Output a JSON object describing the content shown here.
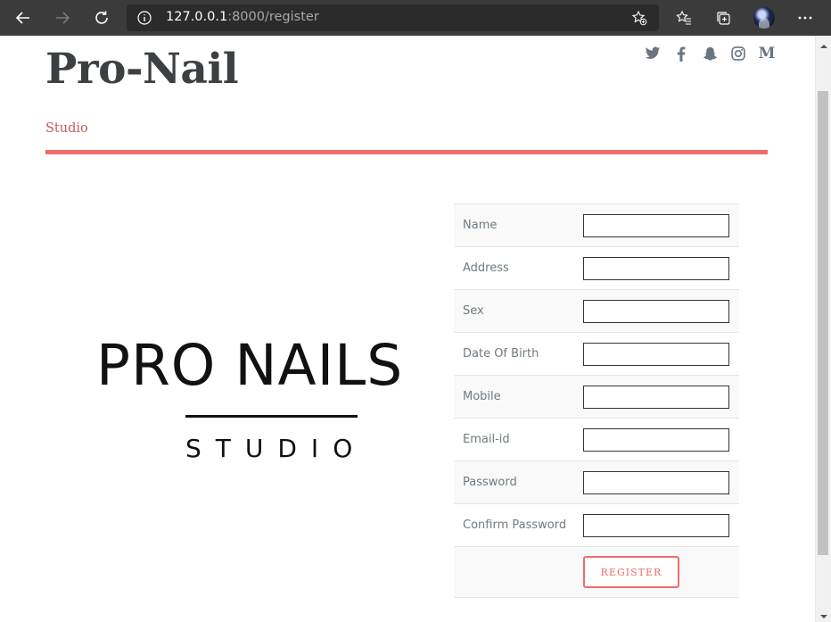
{
  "browser": {
    "url_host": "127.0.0.1",
    "url_rest": ":8000/register",
    "icons": [
      "back-icon",
      "forward-icon",
      "reload-icon",
      "info-icon",
      "add-favorite-icon",
      "favorites-icon",
      "collections-icon",
      "profile-avatar",
      "more-icon"
    ]
  },
  "header": {
    "title": "Pro-Nail",
    "subtitle": "Studio",
    "social": [
      "twitter-icon",
      "facebook-icon",
      "snapchat-icon",
      "instagram-icon",
      "medium-icon"
    ],
    "medium_letter": "M",
    "accent": "#ec6d6b"
  },
  "logo": {
    "brand": "PRO NAILS",
    "tagline": "STUDIO"
  },
  "form": {
    "fields": [
      {
        "label": "Name",
        "value": ""
      },
      {
        "label": "Address",
        "value": ""
      },
      {
        "label": "Sex",
        "value": ""
      },
      {
        "label": "Date Of Birth",
        "value": ""
      },
      {
        "label": "Mobile",
        "value": ""
      },
      {
        "label": "Email-id",
        "value": ""
      },
      {
        "label": "Password",
        "value": ""
      },
      {
        "label": "Confirm Password",
        "value": ""
      }
    ],
    "submit_label": "REGISTER"
  }
}
